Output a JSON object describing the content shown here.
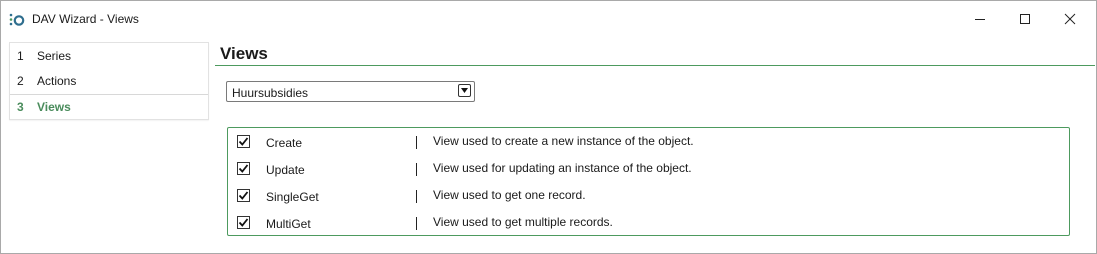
{
  "window": {
    "title": "DAV Wizard - Views",
    "controls": {
      "minimize": "minimize",
      "maximize": "maximize",
      "close": "close"
    }
  },
  "nav": {
    "items": [
      {
        "number": "1",
        "label": "Series",
        "active": false
      },
      {
        "number": "2",
        "label": "Actions",
        "active": false
      },
      {
        "number": "3",
        "label": "Views",
        "active": true
      }
    ]
  },
  "main": {
    "heading": "Views",
    "dropdown": {
      "selected": "Huursubsidies"
    },
    "views": [
      {
        "name": "Create",
        "checked": true,
        "description": "View used to create a new instance of the object."
      },
      {
        "name": "Update",
        "checked": true,
        "description": "View used for updating an instance of the object."
      },
      {
        "name": "SingleGet",
        "checked": true,
        "description": "View used to get one record."
      },
      {
        "name": "MultiGet",
        "checked": true,
        "description": "View used to get multiple records."
      }
    ]
  },
  "colors": {
    "accent": "#4d9a5e",
    "active_nav": "#4a8c5c",
    "app_icon": "#2f6e8e"
  }
}
